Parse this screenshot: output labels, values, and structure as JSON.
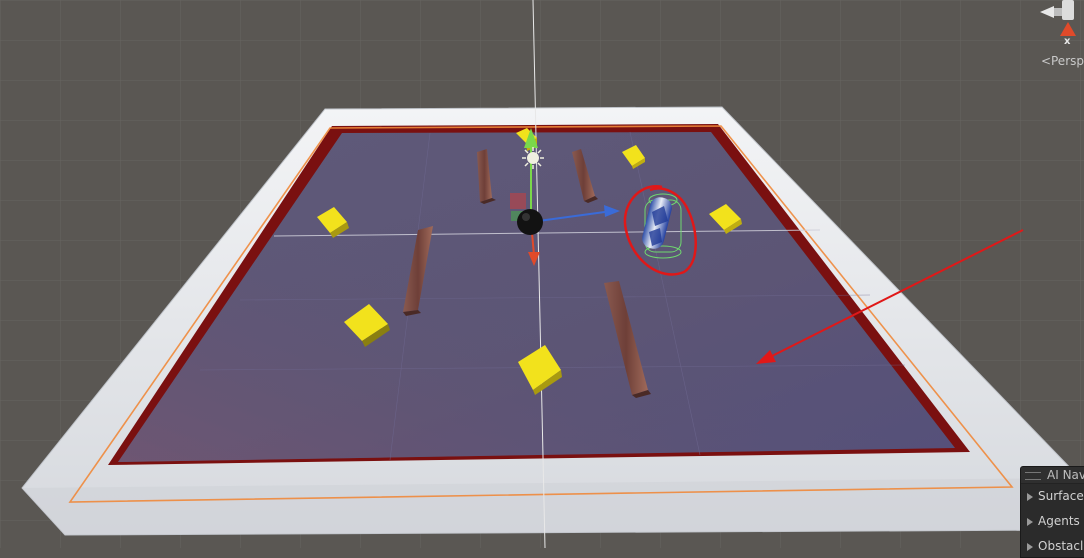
{
  "view": {
    "projection_label": "Persp",
    "axis_label": "x"
  },
  "ai_navigation_overlay": {
    "title": "AI Navi",
    "items": [
      {
        "label": "Surface"
      },
      {
        "label": "Agents"
      },
      {
        "label": "Obstacl"
      }
    ]
  },
  "annotation": {
    "highlight_color": "#e01818",
    "arrow_color": "#e01818"
  },
  "colors": {
    "background": "#5a5753",
    "floor": "#5d5678",
    "wall": "#e6e8ec",
    "trim": "#7a1010",
    "selection_outline": "#f0883a",
    "pickup": "#f2e21c"
  }
}
